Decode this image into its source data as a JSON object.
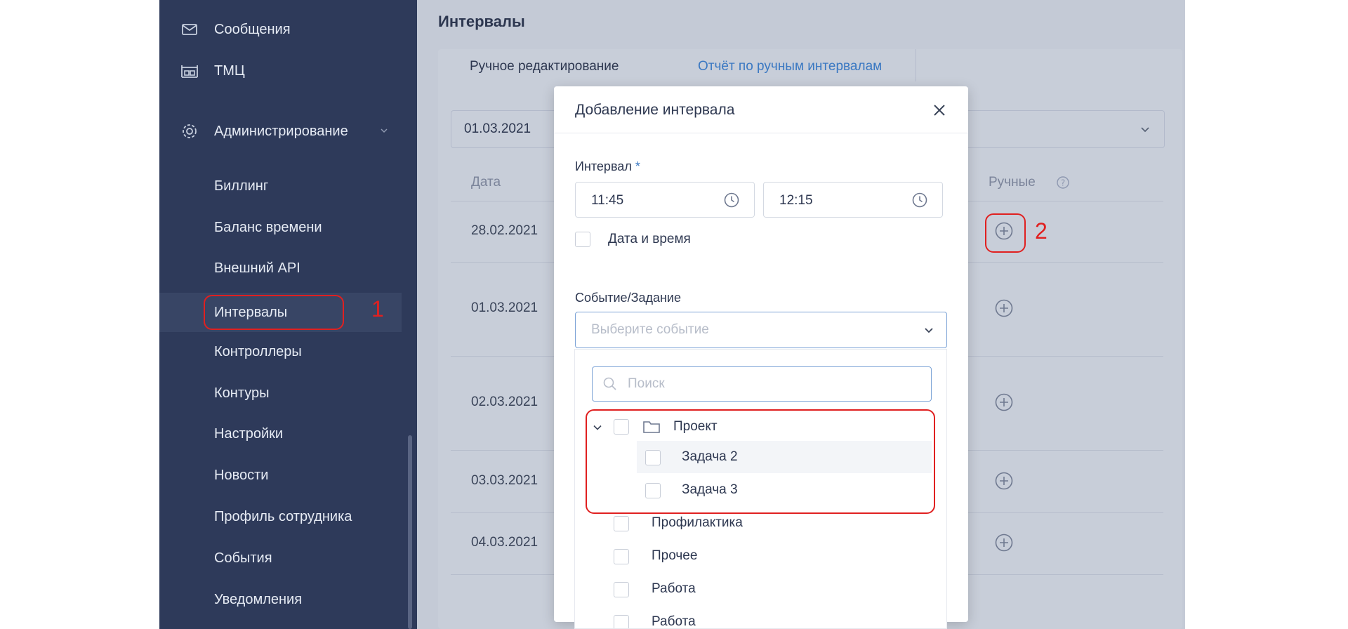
{
  "sidebar": {
    "top_items": [
      {
        "label": "Сообщения",
        "icon": "mail-icon"
      },
      {
        "label": "ТМЦ",
        "icon": "warehouse-icon"
      }
    ],
    "admin": {
      "label": "Администрирование",
      "icon": "gear-icon"
    },
    "sub_items": [
      {
        "label": "Биллинг"
      },
      {
        "label": "Баланс времени"
      },
      {
        "label": "Внешний API"
      },
      {
        "label": "Интервалы",
        "active": true
      },
      {
        "label": "Контроллеры"
      },
      {
        "label": "Контуры"
      },
      {
        "label": "Настройки"
      },
      {
        "label": "Новости"
      },
      {
        "label": "Профиль сотрудника"
      },
      {
        "label": "События"
      },
      {
        "label": "Уведомления"
      }
    ]
  },
  "main": {
    "title": "Интервалы",
    "tabs": [
      {
        "label": "Ручное редактирование"
      },
      {
        "label": "Отчёт по ручным интервалам"
      }
    ],
    "date_select": "01.03.2021",
    "table": {
      "columns": {
        "date": "Дата",
        "manual": "Ручные"
      },
      "rows": [
        "28.02.2021",
        "01.03.2021",
        "02.03.2021",
        "03.03.2021",
        "04.03.2021"
      ]
    }
  },
  "modal": {
    "title": "Добавление интервала",
    "interval_label": "Интервал",
    "required_mark": "*",
    "time_from": "11:45",
    "time_to": "12:15",
    "datetime_label": "Дата и время",
    "event_label": "Событие/Задание",
    "event_placeholder": "Выберите событие",
    "dropdown": {
      "search_placeholder": "Поиск",
      "tree": {
        "folder": "Проект",
        "children": [
          "Задача 2",
          "Задача 3"
        ]
      },
      "items": [
        "Профилактика",
        "Прочее",
        "Работа",
        "Работа"
      ]
    }
  },
  "annotations": {
    "first": "1",
    "second": "2"
  },
  "colors": {
    "sidebar_bg": "#2e3a5a",
    "accent": "#3a78c2",
    "annotation": "#e02020"
  }
}
